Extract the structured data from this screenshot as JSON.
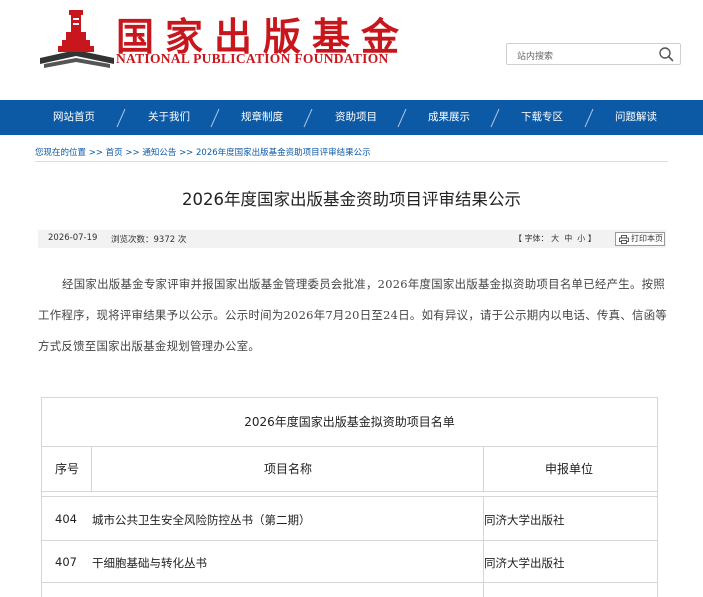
{
  "header": {
    "logo_cn": "国家出版基金",
    "logo_en": "NATIONAL PUBLICATION FOUNDATION",
    "search_placeholder": "站内搜索"
  },
  "nav": {
    "items": [
      "网站首页",
      "关于我们",
      "规章制度",
      "资助项目",
      "成果展示",
      "下载专区",
      "问题解读"
    ]
  },
  "breadcrumb": {
    "prefix": "您现在的位置",
    "sep": ">>",
    "items": [
      "首页",
      "通知公告",
      "2026年度国家出版基金资助项目评审结果公示"
    ]
  },
  "article": {
    "title": "2026年度国家出版基金资助项目评审结果公示",
    "date": "2026-07-19",
    "views_label": "浏览次数：",
    "views": "9372",
    "views_unit": "次",
    "font_label": "【 字体：",
    "font_sizes": [
      "大",
      "中",
      "小"
    ],
    "font_close": "】",
    "print_label": "打印本页",
    "body": "经国家出版基金专家评审并报国家出版基金管理委员会批准，2026年度国家出版基金拟资助项目名单已经产生。按照工作程序，现将评审结果予以公示。公示时间为2026年7月20日至24日。如有异议，请于公示期内以电话、传真、信函等方式反馈至国家出版基金规划管理办公室。"
  },
  "table": {
    "title": "2026年度国家出版基金拟资助项目名单",
    "headers": [
      "序号",
      "项目名称",
      "申报单位"
    ],
    "rows": [
      {
        "no": "404",
        "name": "城市公共卫生安全风险防控丛书（第二期）",
        "unit": "同济大学出版社"
      },
      {
        "no": "407",
        "name": "干细胞基础与转化丛书",
        "unit": "同济大学出版社"
      }
    ]
  },
  "colors": {
    "brand_red": "#c8161d",
    "nav_blue": "#0c5aa6"
  }
}
